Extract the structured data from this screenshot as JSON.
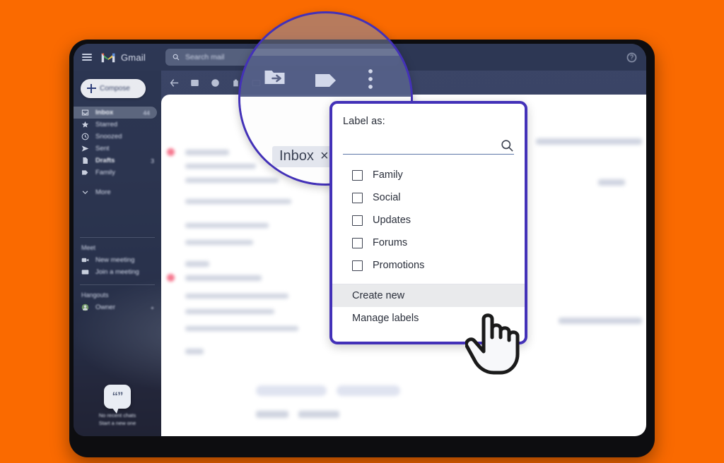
{
  "theme": {
    "background_color": "#FA6A00",
    "accent_purple": "#4331B8",
    "highlight_gray": "#E9EAEC"
  },
  "gmail": {
    "brand": "Gmail",
    "menu_icon": "hamburger-icon",
    "logo_icon": "gmail-m-logo",
    "help_icon": "help-question-icon",
    "search": {
      "placeholder": "Search mail",
      "value": "",
      "icon": "search-icon"
    },
    "compose": {
      "label": "Compose",
      "icon": "plus-icon"
    },
    "nav": [
      {
        "label": "Inbox",
        "icon": "inbox-icon",
        "count": "44",
        "active": true,
        "bold": true
      },
      {
        "label": "Starred",
        "icon": "star-icon",
        "count": "",
        "active": false,
        "bold": false
      },
      {
        "label": "Snoozed",
        "icon": "clock-icon",
        "count": "",
        "active": false,
        "bold": false
      },
      {
        "label": "Sent",
        "icon": "send-icon",
        "count": "",
        "active": false,
        "bold": false
      },
      {
        "label": "Drafts",
        "icon": "draft-icon",
        "count": "3",
        "active": false,
        "bold": true
      },
      {
        "label": "Family",
        "icon": "label-icon",
        "count": "",
        "active": false,
        "bold": false
      },
      {
        "label": "More",
        "icon": "chevron-down-icon",
        "count": "",
        "active": false,
        "bold": false
      }
    ],
    "meet": {
      "header": "Meet",
      "items": [
        {
          "label": "New meeting",
          "icon": "video-camera-icon"
        },
        {
          "label": "Join a meeting",
          "icon": "keyboard-icon"
        }
      ]
    },
    "hangouts": {
      "header": "Hangouts",
      "user": "Owner",
      "add_icon": "plus-icon",
      "empty_title": "No recent chats",
      "empty_subtitle": "Start a new one",
      "bubble_icon": "chat-bubble-icon"
    },
    "toolbar": [
      {
        "label": "Back",
        "icon": "arrow-left-icon"
      },
      {
        "label": "Archive",
        "icon": "archive-icon"
      },
      {
        "label": "Report spam",
        "icon": "report-spam-icon"
      },
      {
        "label": "Delete",
        "icon": "trash-icon"
      },
      {
        "label": "Mark as unread",
        "icon": "mark-unread-icon"
      }
    ],
    "thread_chip": {
      "label": "Inbox",
      "close": "×"
    }
  },
  "magnifier": {
    "icons": [
      {
        "label": "Move to",
        "icon": "move-to-folder-icon"
      },
      {
        "label": "Labels",
        "icon": "label-tag-icon"
      },
      {
        "label": "More options",
        "icon": "more-vertical-icon"
      }
    ],
    "chip": {
      "label": "Inbox",
      "close": "×"
    }
  },
  "dropdown": {
    "title": "Label as:",
    "search": {
      "placeholder": "",
      "value": "",
      "icon": "search-icon"
    },
    "labels": [
      {
        "label": "Family",
        "checked": false
      },
      {
        "label": "Social",
        "checked": false
      },
      {
        "label": "Updates",
        "checked": false
      },
      {
        "label": "Forums",
        "checked": false
      },
      {
        "label": "Promotions",
        "checked": false
      }
    ],
    "actions": [
      {
        "label": "Create new",
        "highlighted": true
      },
      {
        "label": "Manage labels",
        "highlighted": false
      }
    ]
  },
  "cursor": {
    "icon": "pointing-hand-cursor"
  }
}
